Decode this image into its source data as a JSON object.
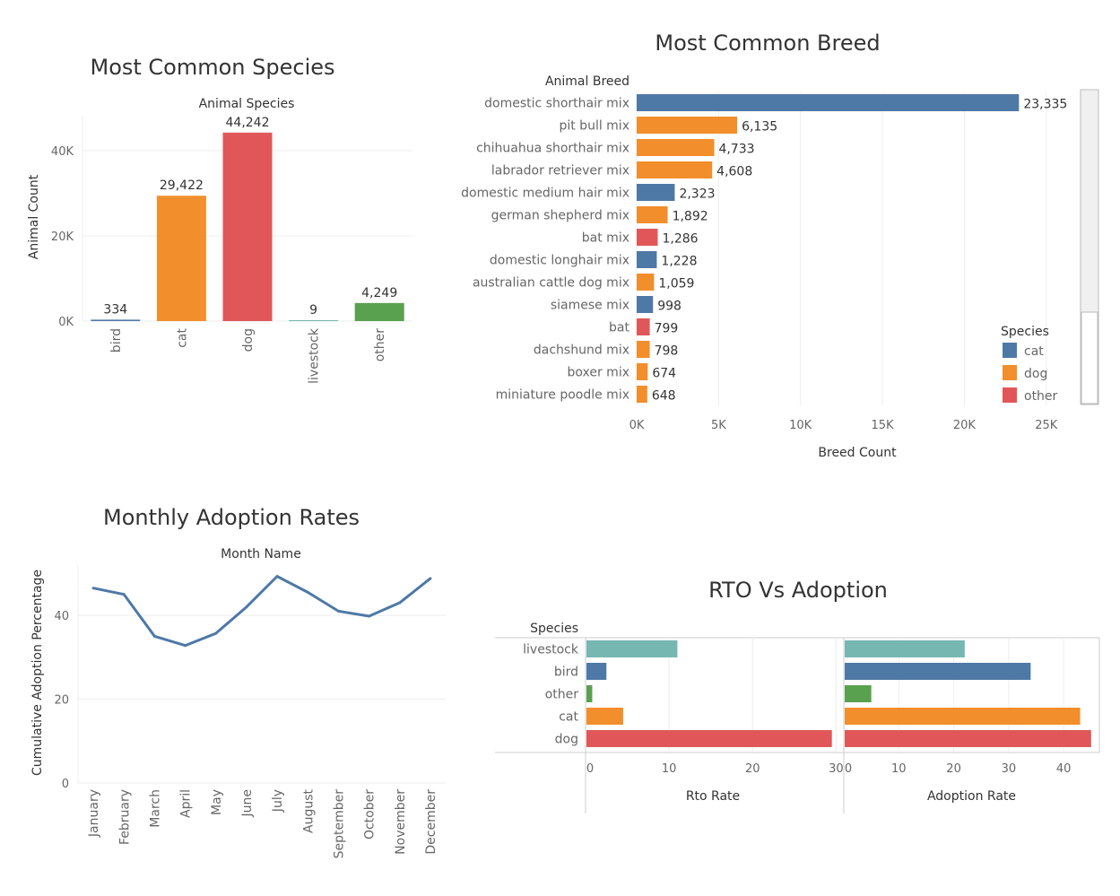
{
  "colors": {
    "cat": "#4e79a7",
    "dog": "#f28e2b",
    "other_breed": "#e15759",
    "bird": "#4e79a7",
    "livestock": "#76b7b2",
    "other": "#59a14f",
    "line": "#4e79a7"
  },
  "chart_data": [
    {
      "type": "bar",
      "title": "Most Common Species",
      "header": "Animal Species",
      "ylabel": "Animal Count",
      "categories": [
        "bird",
        "cat",
        "dog",
        "livestock",
        "other"
      ],
      "values": [
        334,
        29422,
        44242,
        9,
        4249
      ],
      "value_labels": [
        "334",
        "29,422",
        "44,242",
        "9",
        "4,249"
      ],
      "bar_colors": [
        "#4e79a7",
        "#f28e2b",
        "#e15759",
        "#76b7b2",
        "#59a14f"
      ],
      "ylim": [
        0,
        48000
      ],
      "yticks": [
        0,
        20000,
        40000
      ],
      "ytick_labels": [
        "0K",
        "20K",
        "40K"
      ]
    },
    {
      "type": "bar",
      "orientation": "horizontal",
      "title": "Most Common Breed",
      "header": "Animal Breed",
      "xlabel": "Breed Count",
      "categories": [
        "domestic shorthair mix",
        "pit bull mix",
        "chihuahua shorthair mix",
        "labrador retriever mix",
        "domestic medium hair mix",
        "german shepherd mix",
        "bat mix",
        "domestic longhair mix",
        "australian cattle dog mix",
        "siamese mix",
        "bat",
        "dachshund mix",
        "boxer mix",
        "miniature poodle mix"
      ],
      "values": [
        23335,
        6135,
        4733,
        4608,
        2323,
        1892,
        1286,
        1228,
        1059,
        998,
        799,
        798,
        674,
        648
      ],
      "value_labels": [
        "23,335",
        "6,135",
        "4,733",
        "4,608",
        "2,323",
        "1,892",
        "1,286",
        "1,228",
        "1,059",
        "998",
        "799",
        "798",
        "674",
        "648"
      ],
      "species": [
        "cat",
        "dog",
        "dog",
        "dog",
        "cat",
        "dog",
        "other",
        "cat",
        "dog",
        "cat",
        "other",
        "dog",
        "dog",
        "dog"
      ],
      "xlim": [
        0,
        26000
      ],
      "xticks": [
        0,
        5000,
        10000,
        15000,
        20000,
        25000
      ],
      "xtick_labels": [
        "0K",
        "5K",
        "10K",
        "15K",
        "20K",
        "25K"
      ],
      "legend": {
        "title": "Species",
        "placement": "right",
        "entries": [
          {
            "label": "cat",
            "color": "#4e79a7"
          },
          {
            "label": "dog",
            "color": "#f28e2b"
          },
          {
            "label": "other",
            "color": "#e15759"
          }
        ]
      }
    },
    {
      "type": "line",
      "title": "Monthly Adoption Rates",
      "header": "Month Name",
      "ylabel": "Cumulative Adoption Percentage",
      "categories": [
        "January",
        "February",
        "March",
        "April",
        "May",
        "June",
        "July",
        "August",
        "September",
        "October",
        "November",
        "December"
      ],
      "values": [
        46.5,
        45.0,
        35.0,
        32.8,
        35.7,
        42.0,
        49.3,
        45.5,
        41.0,
        39.8,
        43.0,
        48.8
      ],
      "ylim": [
        0,
        52
      ],
      "yticks": [
        0,
        20,
        40
      ],
      "ytick_labels": [
        "0",
        "20",
        "40"
      ]
    },
    {
      "type": "bar",
      "orientation": "horizontal",
      "title": "RTO Vs Adoption",
      "header": "Species",
      "categories": [
        "livestock",
        "bird",
        "other",
        "cat",
        "dog"
      ],
      "bar_colors": [
        "#76b7b2",
        "#4e79a7",
        "#59a14f",
        "#f28e2b",
        "#e15759"
      ],
      "series": [
        {
          "name": "Rto Rate",
          "values": [
            11.0,
            2.5,
            0.8,
            4.5,
            29.5
          ],
          "xlim": [
            0,
            30.5
          ],
          "xticks": [
            0,
            10,
            20,
            30
          ]
        },
        {
          "name": "Adoption Rate",
          "values": [
            22.0,
            34.0,
            5.0,
            43.0,
            45.0
          ],
          "xlim": [
            0,
            46.5
          ],
          "xticks": [
            0,
            10,
            20,
            30,
            40
          ]
        }
      ]
    }
  ]
}
